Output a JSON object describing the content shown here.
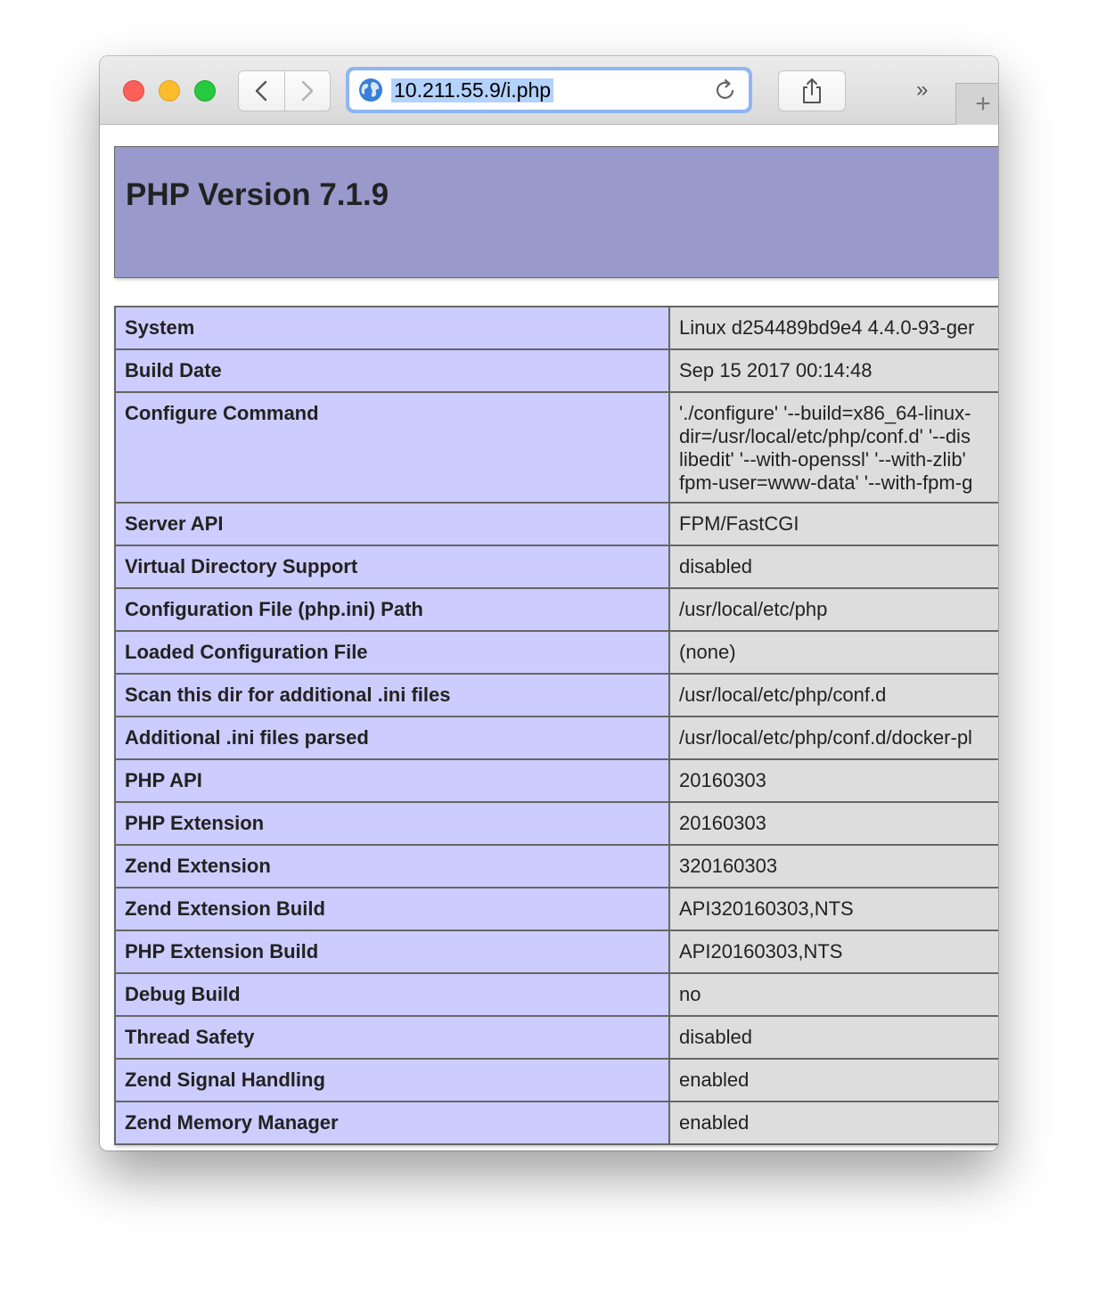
{
  "browser": {
    "url": "10.211.55.9/i.php",
    "overflow_label": "»",
    "new_tab_label": "+"
  },
  "page": {
    "title": "PHP Version 7.1.9",
    "rows": [
      {
        "key": "System",
        "value": "Linux d254489bd9e4 4.4.0-93-ger"
      },
      {
        "key": "Build Date",
        "value": "Sep 15 2017 00:14:48"
      },
      {
        "key": "Configure Command",
        "value": "'./configure' '--build=x86_64-linux-\ndir=/usr/local/etc/php/conf.d' '--dis\nlibedit' '--with-openssl' '--with-zlib'\nfpm-user=www-data' '--with-fpm-g"
      },
      {
        "key": "Server API",
        "value": "FPM/FastCGI"
      },
      {
        "key": "Virtual Directory Support",
        "value": "disabled"
      },
      {
        "key": "Configuration File (php.ini) Path",
        "value": "/usr/local/etc/php"
      },
      {
        "key": "Loaded Configuration File",
        "value": "(none)"
      },
      {
        "key": "Scan this dir for additional .ini files",
        "value": "/usr/local/etc/php/conf.d"
      },
      {
        "key": "Additional .ini files parsed",
        "value": "/usr/local/etc/php/conf.d/docker-pl"
      },
      {
        "key": "PHP API",
        "value": "20160303"
      },
      {
        "key": "PHP Extension",
        "value": "20160303"
      },
      {
        "key": "Zend Extension",
        "value": "320160303"
      },
      {
        "key": "Zend Extension Build",
        "value": "API320160303,NTS"
      },
      {
        "key": "PHP Extension Build",
        "value": "API20160303,NTS"
      },
      {
        "key": "Debug Build",
        "value": "no"
      },
      {
        "key": "Thread Safety",
        "value": "disabled"
      },
      {
        "key": "Zend Signal Handling",
        "value": "enabled"
      },
      {
        "key": "Zend Memory Manager",
        "value": "enabled"
      }
    ]
  }
}
